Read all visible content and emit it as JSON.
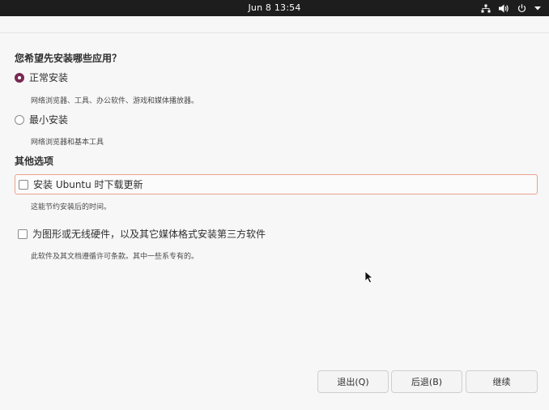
{
  "topbar": {
    "clock": "Jun 8  13:54",
    "icons": [
      "network-icon",
      "volume-icon",
      "power-icon",
      "menu-arrow-icon"
    ]
  },
  "question": "您希望先安装哪些应用？",
  "install_options": [
    {
      "label": "正常安装",
      "description": "网络浏览器、工具、办公软件、游戏和媒体播放器。",
      "selected": true
    },
    {
      "label": "最小安装",
      "description": "网络浏览器和基本工具",
      "selected": false
    }
  ],
  "other_section": {
    "title": "其他选项",
    "options": [
      {
        "label": "安装 Ubuntu 时下载更新",
        "description": "这能节约安装后的时间。",
        "checked": false
      },
      {
        "label": "为图形或无线硬件，以及其它媒体格式安装第三方软件",
        "description": "此软件及其文档遵循许可条款。其中一些系专有的。",
        "checked": false
      }
    ]
  },
  "buttons": {
    "quit": "退出(Q)",
    "back": "后退(B)",
    "continue": "继续"
  },
  "colors": {
    "accent": "#772953",
    "focus_border": "#e9a28c",
    "topbar": "#1d1d1d"
  }
}
